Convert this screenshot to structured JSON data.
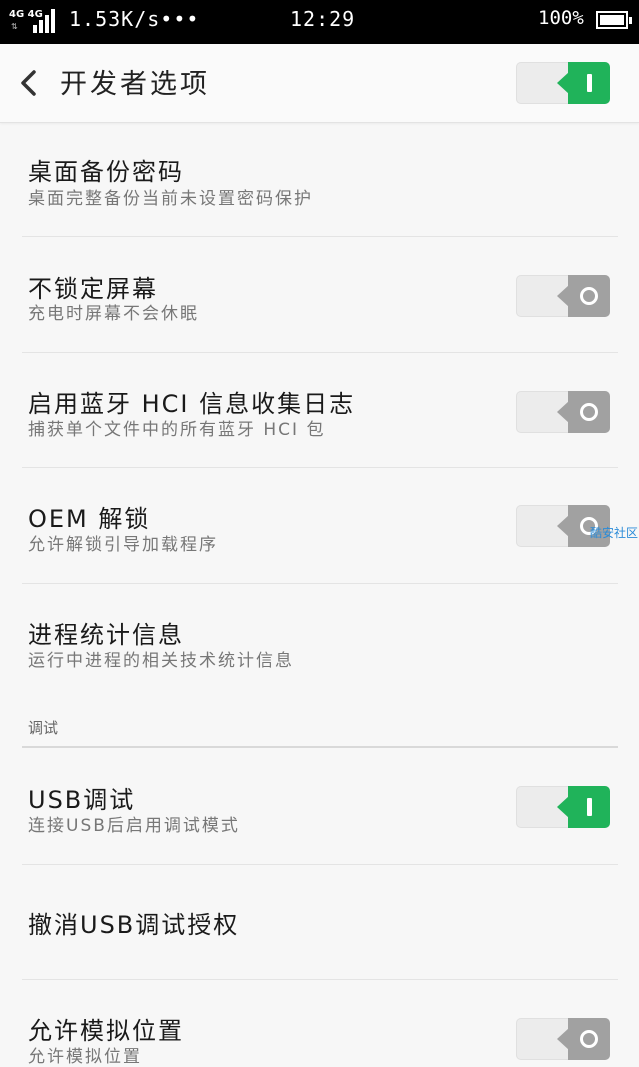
{
  "status_bar": {
    "network": "4G 4G",
    "speed": "1.53K/s•••",
    "time": "12:29",
    "battery": "100%"
  },
  "header": {
    "title": "开发者选项",
    "master_toggle": "on"
  },
  "rows": [
    {
      "title": "桌面备份密码",
      "subtitle": "桌面完整备份当前未设置密码保护"
    },
    {
      "title": "不锁定屏幕",
      "subtitle": "充电时屏幕不会休眠",
      "toggle": "off"
    },
    {
      "title": "启用蓝牙 HCI 信息收集日志",
      "subtitle": "捕获单个文件中的所有蓝牙 HCI 包",
      "toggle": "off"
    },
    {
      "title": "OEM 解锁",
      "subtitle": "允许解锁引导加载程序",
      "toggle": "off"
    },
    {
      "title": "进程统计信息",
      "subtitle": "运行中进程的相关技术统计信息"
    },
    {
      "title": "USB调试",
      "subtitle": "连接USB后启用调试模式",
      "toggle": "on"
    },
    {
      "title": "撤消USB调试授权"
    },
    {
      "title": "允许模拟位置",
      "subtitle": "允许模拟位置",
      "toggle": "off"
    }
  ],
  "section_label": "调试",
  "watermark": "酷安社区",
  "colors": {
    "toggle_on": "#20b35a",
    "toggle_off": "#a1a1a1",
    "background": "#f7f7f7"
  }
}
